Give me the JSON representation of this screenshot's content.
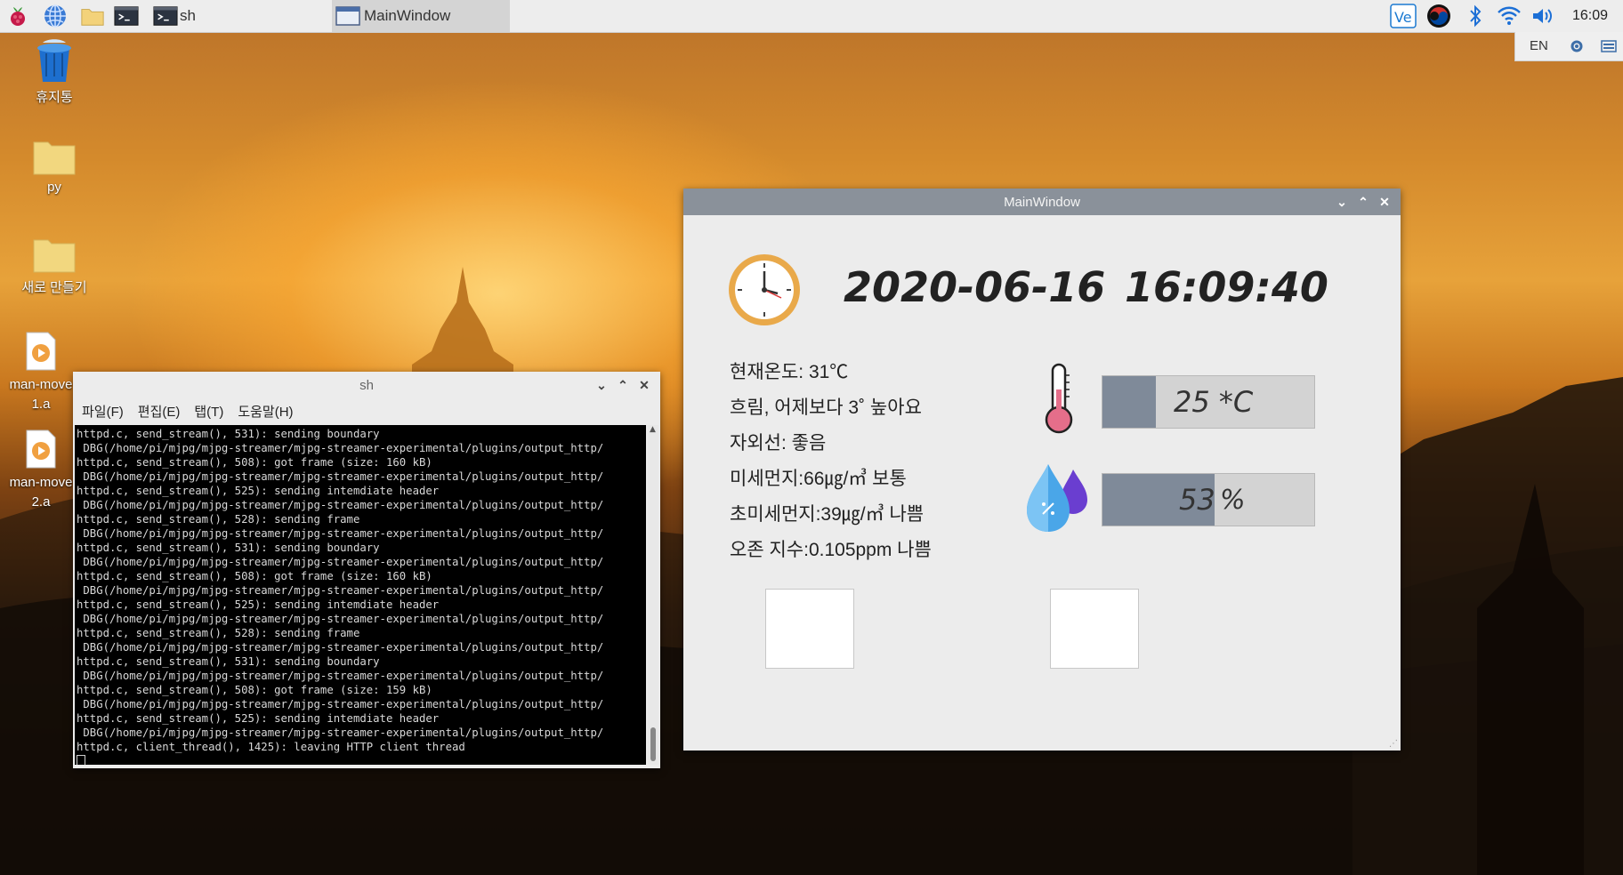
{
  "taskbar": {
    "tasks": [
      {
        "label": "sh"
      },
      {
        "label": "MainWindow"
      }
    ],
    "clock": "16:09",
    "lang": "EN"
  },
  "desktop": {
    "icons": [
      {
        "label": "휴지통"
      },
      {
        "label": "py"
      },
      {
        "label": "새로 만들기"
      },
      {
        "label": "man-move1.a"
      },
      {
        "label": "man-move2.a"
      }
    ]
  },
  "terminal": {
    "title": "sh",
    "menu": [
      "파일(F)",
      "편집(E)",
      "탭(T)",
      "도움말(H)"
    ],
    "lines": [
      "httpd.c, send_stream(), 531): sending boundary",
      " DBG(/home/pi/mjpg/mjpg-streamer/mjpg-streamer-experimental/plugins/output_http/",
      "httpd.c, send_stream(), 508): got frame (size: 160 kB)",
      " DBG(/home/pi/mjpg/mjpg-streamer/mjpg-streamer-experimental/plugins/output_http/",
      "httpd.c, send_stream(), 525): sending intemdiate header",
      " DBG(/home/pi/mjpg/mjpg-streamer/mjpg-streamer-experimental/plugins/output_http/",
      "httpd.c, send_stream(), 528): sending frame",
      " DBG(/home/pi/mjpg/mjpg-streamer/mjpg-streamer-experimental/plugins/output_http/",
      "httpd.c, send_stream(), 531): sending boundary",
      " DBG(/home/pi/mjpg/mjpg-streamer/mjpg-streamer-experimental/plugins/output_http/",
      "httpd.c, send_stream(), 508): got frame (size: 160 kB)",
      " DBG(/home/pi/mjpg/mjpg-streamer/mjpg-streamer-experimental/plugins/output_http/",
      "httpd.c, send_stream(), 525): sending intemdiate header",
      " DBG(/home/pi/mjpg/mjpg-streamer/mjpg-streamer-experimental/plugins/output_http/",
      "httpd.c, send_stream(), 528): sending frame",
      " DBG(/home/pi/mjpg/mjpg-streamer/mjpg-streamer-experimental/plugins/output_http/",
      "httpd.c, send_stream(), 531): sending boundary",
      " DBG(/home/pi/mjpg/mjpg-streamer/mjpg-streamer-experimental/plugins/output_http/",
      "httpd.c, send_stream(), 508): got frame (size: 159 kB)",
      " DBG(/home/pi/mjpg/mjpg-streamer/mjpg-streamer-experimental/plugins/output_http/",
      "httpd.c, send_stream(), 525): sending intemdiate header",
      " DBG(/home/pi/mjpg/mjpg-streamer/mjpg-streamer-experimental/plugins/output_http/",
      "httpd.c, client_thread(), 1425): leaving HTTP client thread"
    ]
  },
  "mainwindow": {
    "title": "MainWindow",
    "date": "2020-06-16",
    "time": "16:09:40",
    "info": [
      "현재온도: 31℃",
      "흐림, 어제보다 3˚ 높아요",
      "자외선: 좋음",
      "미세먼지:66㎍/㎥ 보통",
      "초미세먼지:39㎍/㎥ 나쁨",
      "오존 지수:0.105ppm 나쁨"
    ],
    "temperature": {
      "text": "25 *C",
      "level": 0.25
    },
    "humidity": {
      "value": "53",
      "unit": "%",
      "level": 0.53
    }
  },
  "colors": {
    "gauge_fill": "#7f8a99",
    "gauge_bg": "#d3d3d3",
    "titlebar_active": "#8a919a",
    "titlebar_inactive": "#ececec"
  }
}
